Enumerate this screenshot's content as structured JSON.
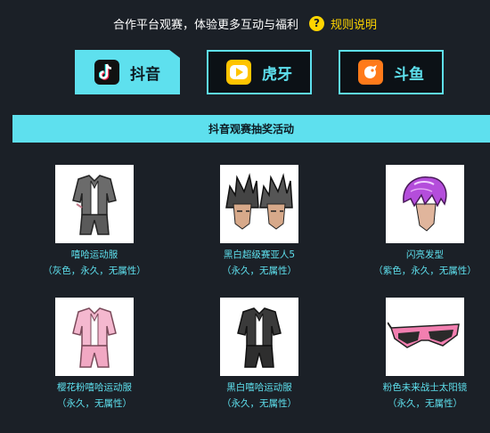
{
  "header": {
    "text": "合作平台观赛，体验更多互动与福利",
    "help_icon": "question-mark-icon",
    "help_glyph": "?",
    "rules_label": "规则说明"
  },
  "tabs": [
    {
      "label": "抖音",
      "icon": "douyin-logo-icon",
      "active": true
    },
    {
      "label": "虎牙",
      "icon": "huya-logo-icon",
      "active": false
    },
    {
      "label": "斗鱼",
      "icon": "douyu-logo-icon",
      "active": false
    }
  ],
  "section": {
    "title": "抖音观赛抽奖活动"
  },
  "prizes": [
    {
      "name": "嘻哈运动服",
      "desc": "（灰色，永久，无属性）"
    },
    {
      "name": "黑白超级赛亚人5",
      "desc": "（永久，无属性）"
    },
    {
      "name": "闪亮发型",
      "desc": "（紫色，永久，无属性）"
    },
    {
      "name": "樱花粉嘻哈运动服",
      "desc": "（永久，无属性）"
    },
    {
      "name": "黑白嘻哈运动服",
      "desc": "（永久，无属性）"
    },
    {
      "name": "粉色未来战士太阳镜",
      "desc": "（永久，无属性）"
    }
  ],
  "colors": {
    "background": "#1b2027",
    "accent": "#5ee0ee",
    "help_yellow": "#ffd500"
  }
}
